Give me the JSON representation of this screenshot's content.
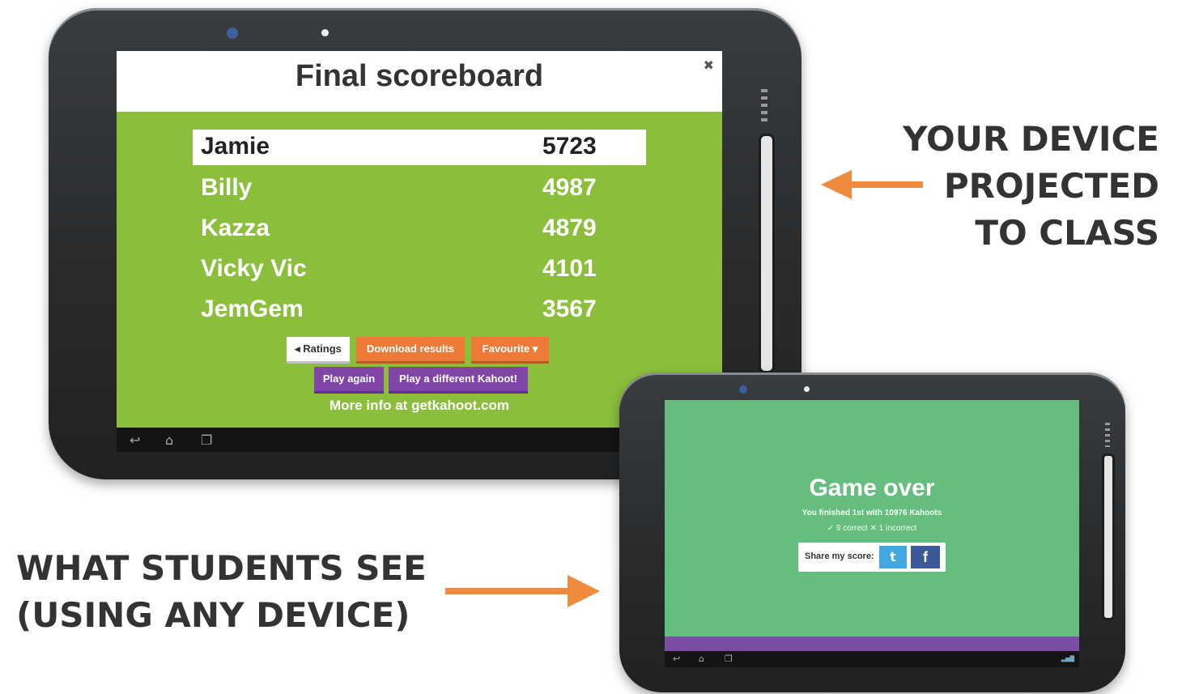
{
  "scoreboard": {
    "title": "Final scoreboard",
    "close_label": "✖",
    "rows": [
      {
        "name": "Jamie",
        "score": "5723"
      },
      {
        "name": "Billy",
        "score": "4987"
      },
      {
        "name": "Kazza",
        "score": "4879"
      },
      {
        "name": "Vicky Vic",
        "score": "4101"
      },
      {
        "name": "JemGem",
        "score": "3567"
      }
    ],
    "buttons": {
      "ratings": "◂ Ratings",
      "download": "Download results",
      "favourite": "Favourite ▾",
      "play_again": "Play again",
      "play_different": "Play a different Kahoot!"
    },
    "more_info": "More info at getkahoot.com",
    "colors": {
      "background": "#8bbf3b",
      "orange": "#ee7a38",
      "purple": "#7f46a8"
    }
  },
  "student_screen": {
    "title": "Game over",
    "line1": "You finished 1st with 10976 Kahoots",
    "line2": "✓ 9 correct ✕ 1 incorrect",
    "share_label": "Share my score:",
    "twitter_glyph": "t",
    "facebook_glyph": "f",
    "colors": {
      "background": "#66be7e",
      "bar": "#7b4da6"
    }
  },
  "captions": {
    "projected": [
      "YOUR DEVICE",
      "PROJECTED",
      "TO CLASS"
    ],
    "students": [
      "WHAT STUDENTS SEE",
      "(USING ANY DEVICE)"
    ]
  },
  "nav_icons": [
    "back-icon",
    "home-icon",
    "recent-apps-icon"
  ],
  "accent_color": "#f08a3c"
}
